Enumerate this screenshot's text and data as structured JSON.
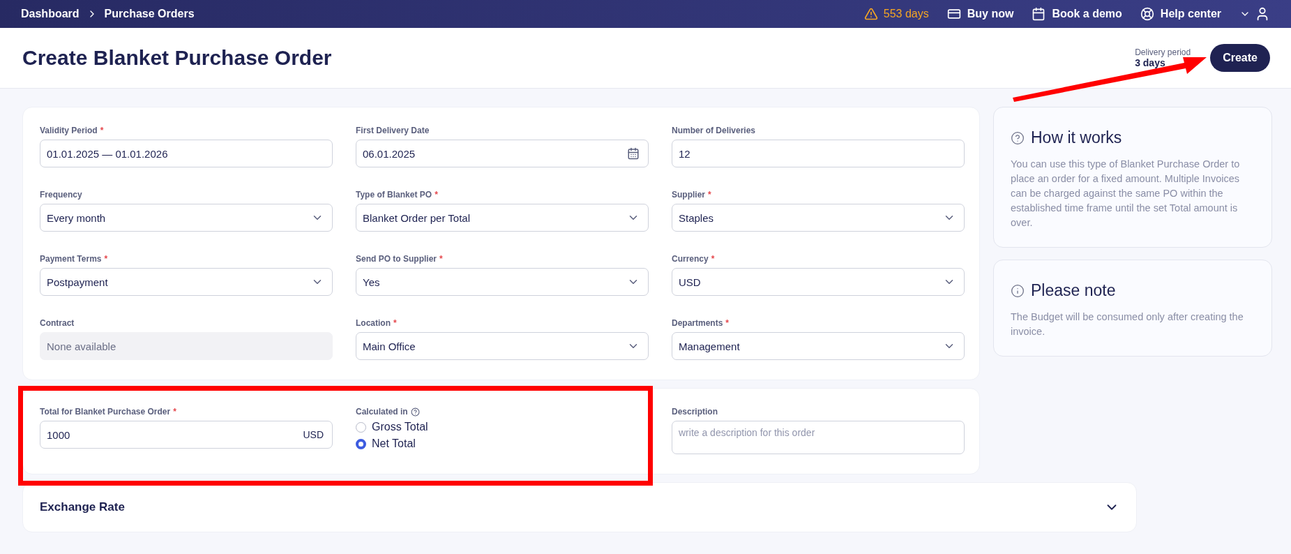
{
  "topbar": {
    "breadcrumbs": [
      "Dashboard",
      "Purchase Orders"
    ],
    "trial": "553 days",
    "actions": [
      {
        "kind": "buy",
        "label": "Buy now"
      },
      {
        "kind": "demo",
        "label": "Book a demo"
      },
      {
        "kind": "help",
        "label": "Help center"
      }
    ]
  },
  "header": {
    "title": "Create Blanket Purchase Order",
    "delivery_label": "Delivery period",
    "delivery_value": "3 days",
    "create_button": "Create"
  },
  "fields": [
    {
      "label": "Validity Period",
      "required_mark": "*",
      "kind": "text",
      "value": "01.01.2025 — 01.01.2026"
    },
    {
      "label": "First Delivery Date",
      "kind": "date",
      "value": "06.01.2025"
    },
    {
      "label": "Number of Deliveries",
      "kind": "text",
      "value": "12"
    },
    {
      "label": "Frequency",
      "kind": "select",
      "value": "Every month"
    },
    {
      "label": "Type of Blanket PO",
      "required_mark": "*",
      "kind": "select",
      "value": "Blanket Order per Total"
    },
    {
      "label": "Supplier",
      "required_mark": "*",
      "kind": "select",
      "value": "Staples"
    },
    {
      "label": "Payment Terms",
      "required_mark": "*",
      "kind": "select",
      "value": "Postpayment"
    },
    {
      "label": "Send PO to Supplier",
      "required_mark": "*",
      "kind": "select",
      "value": "Yes"
    },
    {
      "label": "Currency",
      "required_mark": "*",
      "kind": "select",
      "value": "USD"
    },
    {
      "label": "Contract",
      "kind": "disabled",
      "value": "None available"
    },
    {
      "label": "Location",
      "required_mark": "*",
      "kind": "select",
      "value": "Main Office"
    },
    {
      "label": "Departments",
      "required_mark": "*",
      "kind": "select",
      "value": "Management"
    }
  ],
  "total": {
    "label": "Total for Blanket Purchase Order",
    "required_mark": "*",
    "value": "1000",
    "currency": "USD"
  },
  "calculated_in": {
    "label": "Calculated in",
    "options": [
      {
        "label": "Gross Total",
        "selected": false
      },
      {
        "label": "Net Total",
        "selected": true
      }
    ]
  },
  "description": {
    "label": "Description",
    "placeholder": "write a description for this order"
  },
  "info_cards": [
    {
      "kind": "help",
      "title": "How it works",
      "text": "You can use this type of Blanket Purchase Order to place an order for a fixed amount. Multiple Invoices can be charged against the same PO within the established time frame until the set Total amount is over."
    },
    {
      "kind": "info",
      "title": "Please note",
      "text": "The Budget will be consumed only after creating the invoice."
    }
  ],
  "exchange_rate": {
    "title": "Exchange Rate",
    "expanded": false
  }
}
